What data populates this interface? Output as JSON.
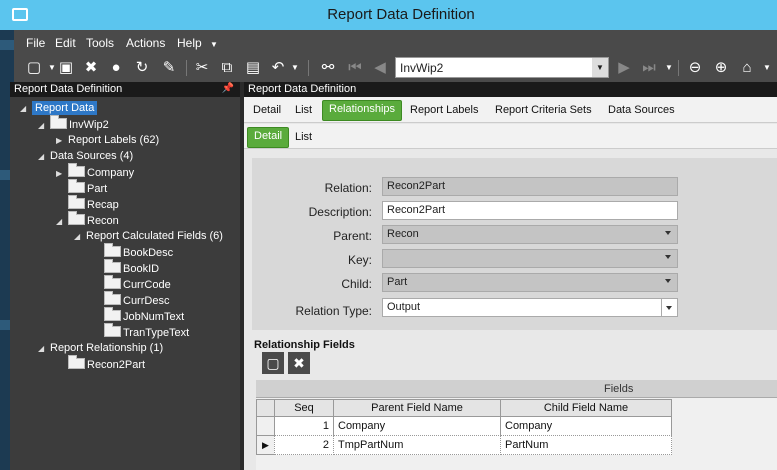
{
  "window": {
    "title": "Report Data Definition",
    "app_icon": "window-icon"
  },
  "menu": [
    "File",
    "Edit",
    "Tools",
    "Actions",
    "Help"
  ],
  "toolbar": {
    "report_combo_value": "InvWip2"
  },
  "left_panel": {
    "header": "Report Data Definition",
    "tree": [
      {
        "label": "Report Data",
        "level": 0,
        "toggle": "expanded",
        "folder": false,
        "selected": true
      },
      {
        "label": "InvWip2",
        "level": 1,
        "toggle": "expanded",
        "folder": true
      },
      {
        "label": "Report Labels (62)",
        "level": 2,
        "toggle": "collapsed",
        "folder": false
      },
      {
        "label": "Data Sources (4)",
        "level": 1,
        "toggle": "expanded",
        "folder": false
      },
      {
        "label": "Company",
        "level": 2,
        "toggle": "collapsed",
        "folder": true
      },
      {
        "label": "Part",
        "level": 2,
        "toggle": "none",
        "folder": true
      },
      {
        "label": "Recap",
        "level": 2,
        "toggle": "none",
        "folder": true
      },
      {
        "label": "Recon",
        "level": 2,
        "toggle": "expanded",
        "folder": true
      },
      {
        "label": "Report Calculated Fields (6)",
        "level": 3,
        "toggle": "expanded",
        "folder": false
      },
      {
        "label": "BookDesc",
        "level": 4,
        "toggle": "none",
        "folder": true
      },
      {
        "label": "BookID",
        "level": 4,
        "toggle": "none",
        "folder": true
      },
      {
        "label": "CurrCode",
        "level": 4,
        "toggle": "none",
        "folder": true
      },
      {
        "label": "CurrDesc",
        "level": 4,
        "toggle": "none",
        "folder": true
      },
      {
        "label": "JobNumText",
        "level": 4,
        "toggle": "none",
        "folder": true
      },
      {
        "label": "TranTypeText",
        "level": 4,
        "toggle": "none",
        "folder": true
      },
      {
        "label": "Report Relationship (1)",
        "level": 1,
        "toggle": "expanded",
        "folder": false
      },
      {
        "label": "Recon2Part",
        "level": 2,
        "toggle": "none",
        "folder": true
      }
    ]
  },
  "right_panel": {
    "header": "Report Data Definition",
    "tabs": [
      "Detail",
      "List",
      "Relationships",
      "Report Labels",
      "Report Criteria Sets",
      "Data Sources"
    ],
    "active_tab": "Relationships",
    "subtabs": [
      "Detail",
      "List"
    ],
    "active_subtab": "Detail",
    "form": {
      "relation_label": "Relation:",
      "relation_value": "Recon2Part",
      "description_label": "Description:",
      "description_value": "Recon2Part",
      "parent_label": "Parent:",
      "parent_value": "Recon",
      "key_label": "Key:",
      "key_value": "",
      "child_label": "Child:",
      "child_value": "Part",
      "relation_type_label": "Relation Type:",
      "relation_type_value": "Output"
    },
    "relationship_fields": {
      "title": "Relationship Fields",
      "group_header": "Fields",
      "columns": [
        "Seq",
        "Parent Field Name",
        "Child Field Name"
      ],
      "rows": [
        {
          "seq": "1",
          "parent": "Company",
          "child": "Company"
        },
        {
          "seq": "2",
          "parent": "TmpPartNum",
          "child": "PartNum"
        }
      ]
    }
  }
}
